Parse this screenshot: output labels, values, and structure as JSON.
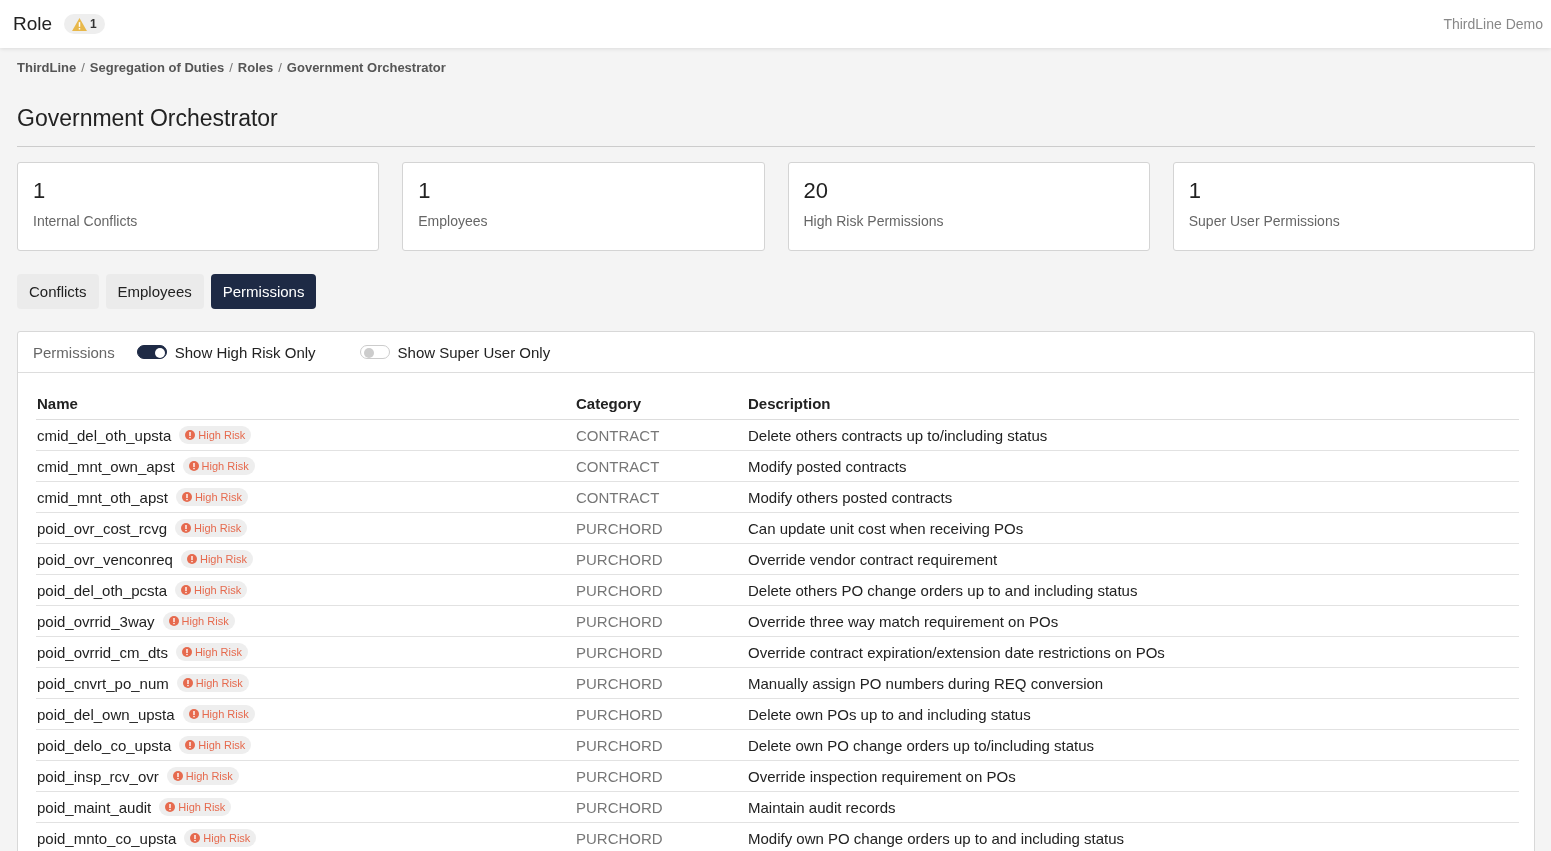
{
  "header": {
    "title": "Role",
    "alert_count": "1",
    "account": "ThirdLine Demo"
  },
  "breadcrumb": [
    "ThirdLine",
    "Segregation of Duties",
    "Roles",
    "Government Orchestrator"
  ],
  "breadcrumb_separator": "/",
  "page_title": "Government Orchestrator",
  "stats": [
    {
      "value": "1",
      "label": "Internal Conflicts"
    },
    {
      "value": "1",
      "label": "Employees"
    },
    {
      "value": "20",
      "label": "High Risk Permissions"
    },
    {
      "value": "1",
      "label": "Super User Permissions"
    }
  ],
  "tabs": [
    {
      "label": "Conflicts",
      "selected": false
    },
    {
      "label": "Employees",
      "selected": false
    },
    {
      "label": "Permissions",
      "selected": true
    }
  ],
  "panel": {
    "title": "Permissions",
    "toggles": [
      {
        "label": "Show High Risk Only",
        "on": true
      },
      {
        "label": "Show Super User Only",
        "on": false
      }
    ],
    "table": {
      "columns": [
        "Name",
        "Category",
        "Description"
      ],
      "rows": [
        {
          "name": "cmid_del_oth_upsta",
          "badge": {
            "kind": "high_risk",
            "label": "High Risk"
          },
          "category": "CONTRACT",
          "description": "Delete others contracts up to/including status"
        },
        {
          "name": "cmid_mnt_own_apst",
          "badge": {
            "kind": "high_risk",
            "label": "High Risk"
          },
          "category": "CONTRACT",
          "description": "Modify posted contracts"
        },
        {
          "name": "cmid_mnt_oth_apst",
          "badge": {
            "kind": "high_risk",
            "label": "High Risk"
          },
          "category": "CONTRACT",
          "description": "Modify others posted contracts"
        },
        {
          "name": "poid_ovr_cost_rcvg",
          "badge": {
            "kind": "high_risk",
            "label": "High Risk"
          },
          "category": "PURCHORD",
          "description": "Can update unit cost when receiving POs"
        },
        {
          "name": "poid_ovr_venconreq",
          "badge": {
            "kind": "high_risk",
            "label": "High Risk"
          },
          "category": "PURCHORD",
          "description": "Override vendor contract requirement"
        },
        {
          "name": "poid_del_oth_pcsta",
          "badge": {
            "kind": "high_risk",
            "label": "High Risk"
          },
          "category": "PURCHORD",
          "description": "Delete others PO change orders up to and including status"
        },
        {
          "name": "poid_ovrrid_3way",
          "badge": {
            "kind": "high_risk",
            "label": "High Risk"
          },
          "category": "PURCHORD",
          "description": "Override three way match requirement on POs"
        },
        {
          "name": "poid_ovrrid_cm_dts",
          "badge": {
            "kind": "high_risk",
            "label": "High Risk"
          },
          "category": "PURCHORD",
          "description": "Override contract expiration/extension date restrictions on POs"
        },
        {
          "name": "poid_cnvrt_po_num",
          "badge": {
            "kind": "high_risk",
            "label": "High Risk"
          },
          "category": "PURCHORD",
          "description": "Manually assign PO numbers during REQ conversion"
        },
        {
          "name": "poid_del_own_upsta",
          "badge": {
            "kind": "high_risk",
            "label": "High Risk"
          },
          "category": "PURCHORD",
          "description": "Delete own POs up to and including status"
        },
        {
          "name": "poid_delo_co_upsta",
          "badge": {
            "kind": "high_risk",
            "label": "High Risk"
          },
          "category": "PURCHORD",
          "description": "Delete own PO change orders up to/including status"
        },
        {
          "name": "poid_insp_rcv_ovr",
          "badge": {
            "kind": "high_risk",
            "label": "High Risk"
          },
          "category": "PURCHORD",
          "description": "Override inspection requirement on POs"
        },
        {
          "name": "poid_maint_audit",
          "badge": {
            "kind": "high_risk",
            "label": "High Risk"
          },
          "category": "PURCHORD",
          "description": "Maintain audit records"
        },
        {
          "name": "poid_mnto_co_upsta",
          "badge": {
            "kind": "high_risk",
            "label": "High Risk"
          },
          "category": "PURCHORD",
          "description": "Modify own PO change orders up to and including status"
        }
      ]
    }
  }
}
